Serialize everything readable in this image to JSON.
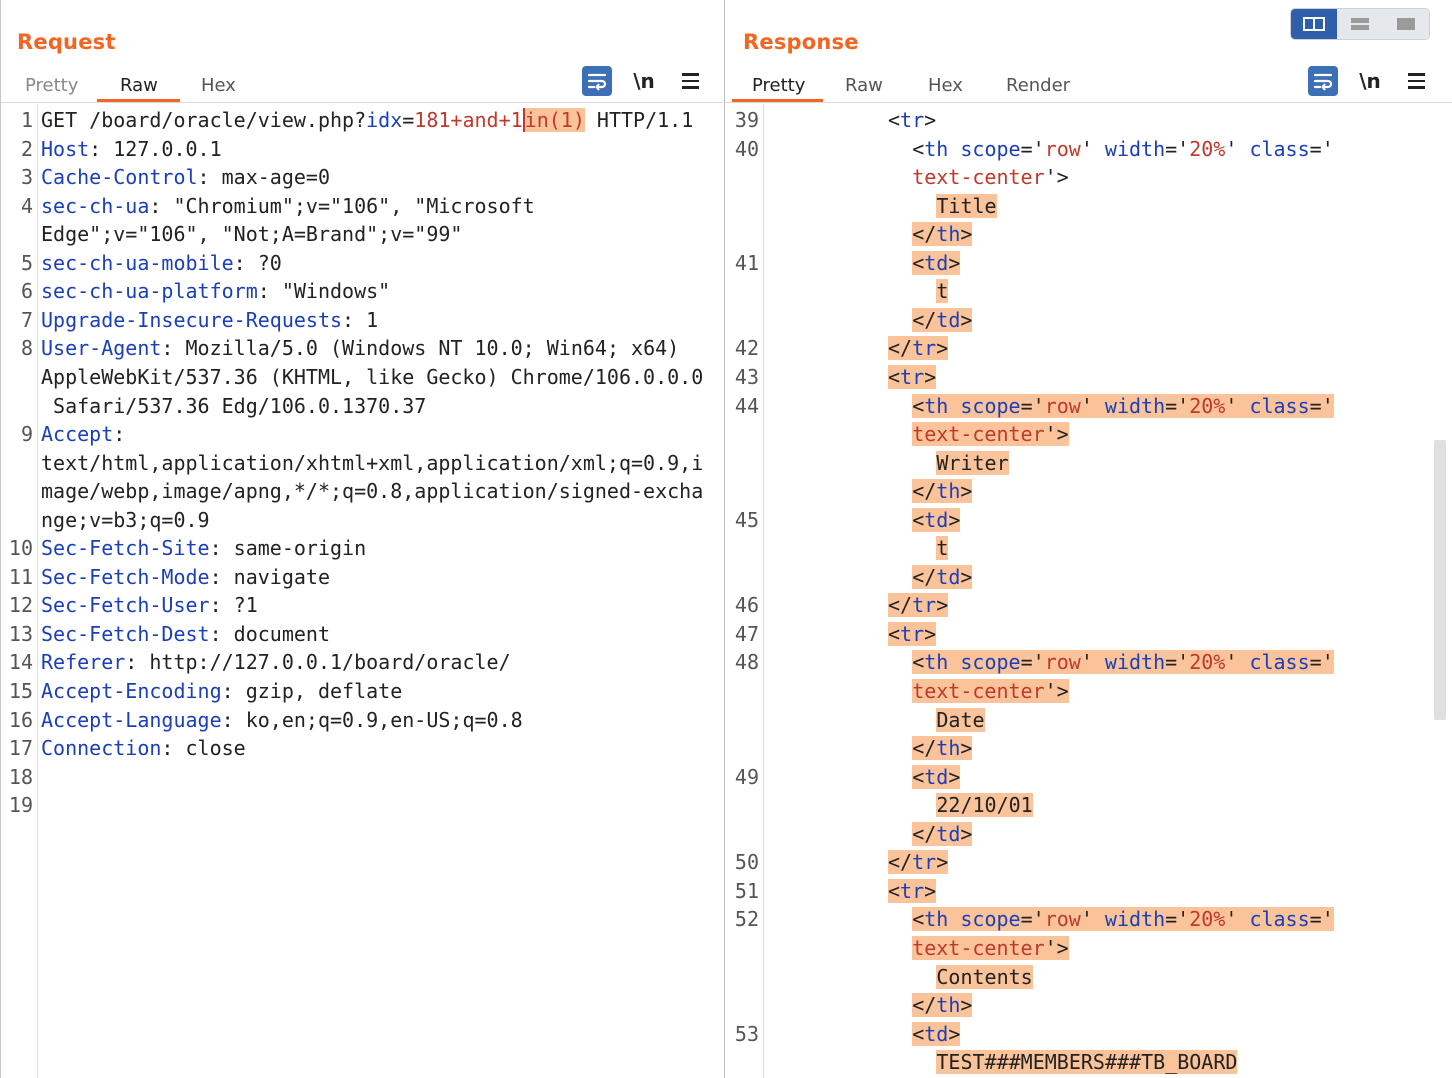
{
  "request": {
    "title": "Request",
    "tabs": [
      "Pretty",
      "Raw",
      "Hex"
    ],
    "active_tab": "Raw",
    "icons": [
      "wrap-icon",
      "newline-icon",
      "menu-icon"
    ],
    "newline_label": "\\n",
    "line_numbers": [
      "1",
      "",
      "2",
      "3",
      "4",
      "",
      "5",
      "6",
      "7",
      "8",
      "",
      "",
      "9",
      "",
      "",
      "",
      "",
      "10",
      "11",
      "12",
      "13",
      "14",
      "15",
      "16",
      "17",
      "18",
      "19"
    ],
    "lines": [
      {
        "n": "1",
        "html": "GET /board/oracle/view.php?<span class=\"k\">idx</span>=<span class=\"v\">181+and+1</span><span class=\"cur\"></span><span class=\"hl v\">in(1)</span> HTTP/1.1"
      },
      {
        "n": "2",
        "html": "<span class=\"k\">Host</span>: 127.0.0.1"
      },
      {
        "n": "3",
        "html": "<span class=\"k\">Cache-Control</span>: max-age=0"
      },
      {
        "n": "4",
        "html": "<span class=\"k\">sec-ch-ua</span>: \"Chromium\";v=\"106\", \"Microsoft"
      },
      {
        "n": "",
        "html": "Edge\";v=\"106\", \"Not;A=Brand\";v=\"99\""
      },
      {
        "n": "5",
        "html": "<span class=\"k\">sec-ch-ua-mobile</span>: ?0"
      },
      {
        "n": "6",
        "html": "<span class=\"k\">sec-ch-ua-platform</span>: \"Windows\""
      },
      {
        "n": "7",
        "html": "<span class=\"k\">Upgrade-Insecure-Requests</span>: 1"
      },
      {
        "n": "8",
        "html": "<span class=\"k\">User-Agent</span>: Mozilla/5.0 (Windows NT 10.0; Win64; x64)"
      },
      {
        "n": "",
        "html": "AppleWebKit/537.36 (KHTML, like Gecko) Chrome/106.0.0.0"
      },
      {
        "n": "",
        "html": " Safari/537.36 Edg/106.0.1370.37"
      },
      {
        "n": "9",
        "html": "<span class=\"k\">Accept</span>:"
      },
      {
        "n": "",
        "html": "text/html,application/xhtml+xml,application/xml;q=0.9,i"
      },
      {
        "n": "",
        "html": "mage/webp,image/apng,*/*;q=0.8,application/signed-excha"
      },
      {
        "n": "",
        "html": "nge;v=b3;q=0.9"
      },
      {
        "n": "10",
        "html": "<span class=\"k\">Sec-Fetch-Site</span>: same-origin"
      },
      {
        "n": "11",
        "html": "<span class=\"k\">Sec-Fetch-Mode</span>: navigate"
      },
      {
        "n": "12",
        "html": "<span class=\"k\">Sec-Fetch-User</span>: ?1"
      },
      {
        "n": "13",
        "html": "<span class=\"k\">Sec-Fetch-Dest</span>: document"
      },
      {
        "n": "14",
        "html": "<span class=\"k\">Referer</span>: http://127.0.0.1/board/oracle/"
      },
      {
        "n": "15",
        "html": "<span class=\"k\">Accept-Encoding</span>: gzip, deflate"
      },
      {
        "n": "16",
        "html": "<span class=\"k\">Accept-Language</span>: ko,en;q=0.9,en-US;q=0.8"
      },
      {
        "n": "17",
        "html": "<span class=\"k\">Connection</span>: close"
      },
      {
        "n": "18",
        "html": ""
      },
      {
        "n": "19",
        "html": ""
      }
    ]
  },
  "response": {
    "title": "Response",
    "tabs": [
      "Pretty",
      "Raw",
      "Hex",
      "Render"
    ],
    "active_tab": "Pretty",
    "icons": [
      "wrap-icon",
      "newline-icon",
      "menu-icon"
    ],
    "newline_label": "\\n",
    "lines": [
      {
        "n": "39",
        "indent": 5,
        "html": "&lt;<span class=\"t\">tr</span>&gt;"
      },
      {
        "n": "40",
        "indent": 6,
        "html": "&lt;<span class=\"t\">th</span> <span class=\"k\">scope</span>='<span class=\"v\">row</span>' <span class=\"k\">width</span>='<span class=\"v\">20%</span>' <span class=\"k\">class</span>='"
      },
      {
        "n": "",
        "indent": 6,
        "html": "<span class=\"v\">text-center</span>'&gt;"
      },
      {
        "n": "",
        "indent": 7,
        "html": "<span class=\"hl\">Title</span>"
      },
      {
        "n": "",
        "indent": 6,
        "html": "<span class=\"hl\">&lt;/<span class=\"t\">th</span>&gt;</span>"
      },
      {
        "n": "41",
        "indent": 6,
        "html": "<span class=\"hl\">&lt;<span class=\"t\">td</span>&gt;</span>"
      },
      {
        "n": "",
        "indent": 7,
        "html": "<span class=\"hl\">t</span>"
      },
      {
        "n": "",
        "indent": 6,
        "html": "<span class=\"hl\">&lt;/<span class=\"t\">td</span>&gt;</span>"
      },
      {
        "n": "42",
        "indent": 5,
        "html": "<span class=\"hl\">&lt;/<span class=\"t\">tr</span>&gt;</span>"
      },
      {
        "n": "43",
        "indent": 5,
        "html": "<span class=\"hl\">&lt;<span class=\"t\">tr</span>&gt;</span>"
      },
      {
        "n": "44",
        "indent": 6,
        "html": "<span class=\"hl\">&lt;<span class=\"t\">th</span> <span class=\"k\">scope</span>='<span class=\"v\">row</span>' <span class=\"k\">width</span>='<span class=\"v\">20%</span>' <span class=\"k\">class</span>='</span>"
      },
      {
        "n": "",
        "indent": 6,
        "html": "<span class=\"hl\"><span class=\"v\">text-center</span>'&gt;</span>"
      },
      {
        "n": "",
        "indent": 7,
        "html": "<span class=\"hl\">Writer</span>"
      },
      {
        "n": "",
        "indent": 6,
        "html": "<span class=\"hl\">&lt;/<span class=\"t\">th</span>&gt;</span>"
      },
      {
        "n": "45",
        "indent": 6,
        "html": "<span class=\"hl\">&lt;<span class=\"t\">td</span>&gt;</span>"
      },
      {
        "n": "",
        "indent": 7,
        "html": "<span class=\"hl\">t</span>"
      },
      {
        "n": "",
        "indent": 6,
        "html": "<span class=\"hl\">&lt;/<span class=\"t\">td</span>&gt;</span>"
      },
      {
        "n": "46",
        "indent": 5,
        "html": "<span class=\"hl\">&lt;/<span class=\"t\">tr</span>&gt;</span>"
      },
      {
        "n": "47",
        "indent": 5,
        "html": "<span class=\"hl\">&lt;<span class=\"t\">tr</span>&gt;</span>"
      },
      {
        "n": "48",
        "indent": 6,
        "html": "<span class=\"hl\">&lt;<span class=\"t\">th</span> <span class=\"k\">scope</span>='<span class=\"v\">row</span>' <span class=\"k\">width</span>='<span class=\"v\">20%</span>' <span class=\"k\">class</span>='</span>"
      },
      {
        "n": "",
        "indent": 6,
        "html": "<span class=\"hl\"><span class=\"v\">text-center</span>'&gt;</span>"
      },
      {
        "n": "",
        "indent": 7,
        "html": "<span class=\"hl\">Date</span>"
      },
      {
        "n": "",
        "indent": 6,
        "html": "<span class=\"hl\">&lt;/<span class=\"t\">th</span>&gt;</span>"
      },
      {
        "n": "49",
        "indent": 6,
        "html": "<span class=\"hl\">&lt;<span class=\"t\">td</span>&gt;</span>"
      },
      {
        "n": "",
        "indent": 7,
        "html": "<span class=\"hl\">22/10/01</span>"
      },
      {
        "n": "",
        "indent": 6,
        "html": "<span class=\"hl\">&lt;/<span class=\"t\">td</span>&gt;</span>"
      },
      {
        "n": "50",
        "indent": 5,
        "html": "<span class=\"hl\">&lt;/<span class=\"t\">tr</span>&gt;</span>"
      },
      {
        "n": "51",
        "indent": 5,
        "html": "<span class=\"hl\">&lt;<span class=\"t\">tr</span>&gt;</span>"
      },
      {
        "n": "52",
        "indent": 6,
        "html": "<span class=\"hl\">&lt;<span class=\"t\">th</span> <span class=\"k\">scope</span>='<span class=\"v\">row</span>' <span class=\"k\">width</span>='<span class=\"v\">20%</span>' <span class=\"k\">class</span>='</span>"
      },
      {
        "n": "",
        "indent": 6,
        "html": "<span class=\"hl\"><span class=\"v\">text-center</span>'&gt;</span>"
      },
      {
        "n": "",
        "indent": 7,
        "html": "<span class=\"hl\">Contents</span>"
      },
      {
        "n": "",
        "indent": 6,
        "html": "<span class=\"hl\">&lt;/<span class=\"t\">th</span>&gt;</span>"
      },
      {
        "n": "53",
        "indent": 6,
        "html": "<span class=\"hl\">&lt;<span class=\"t\">td</span>&gt;</span>"
      },
      {
        "n": "",
        "indent": 7,
        "html": "<span class=\"hl\">TEST###MEMBERS###TB_BOARD</span>"
      }
    ]
  },
  "layout_toggle": [
    "split-horizontal-icon",
    "split-vertical-icon",
    "single-pane-icon"
  ],
  "colors": {
    "accent": "#f26522",
    "key": "#1a3fb8",
    "value": "#c0392b",
    "highlight": "#fbc39a",
    "icon_bg": "#3c6fb6"
  }
}
